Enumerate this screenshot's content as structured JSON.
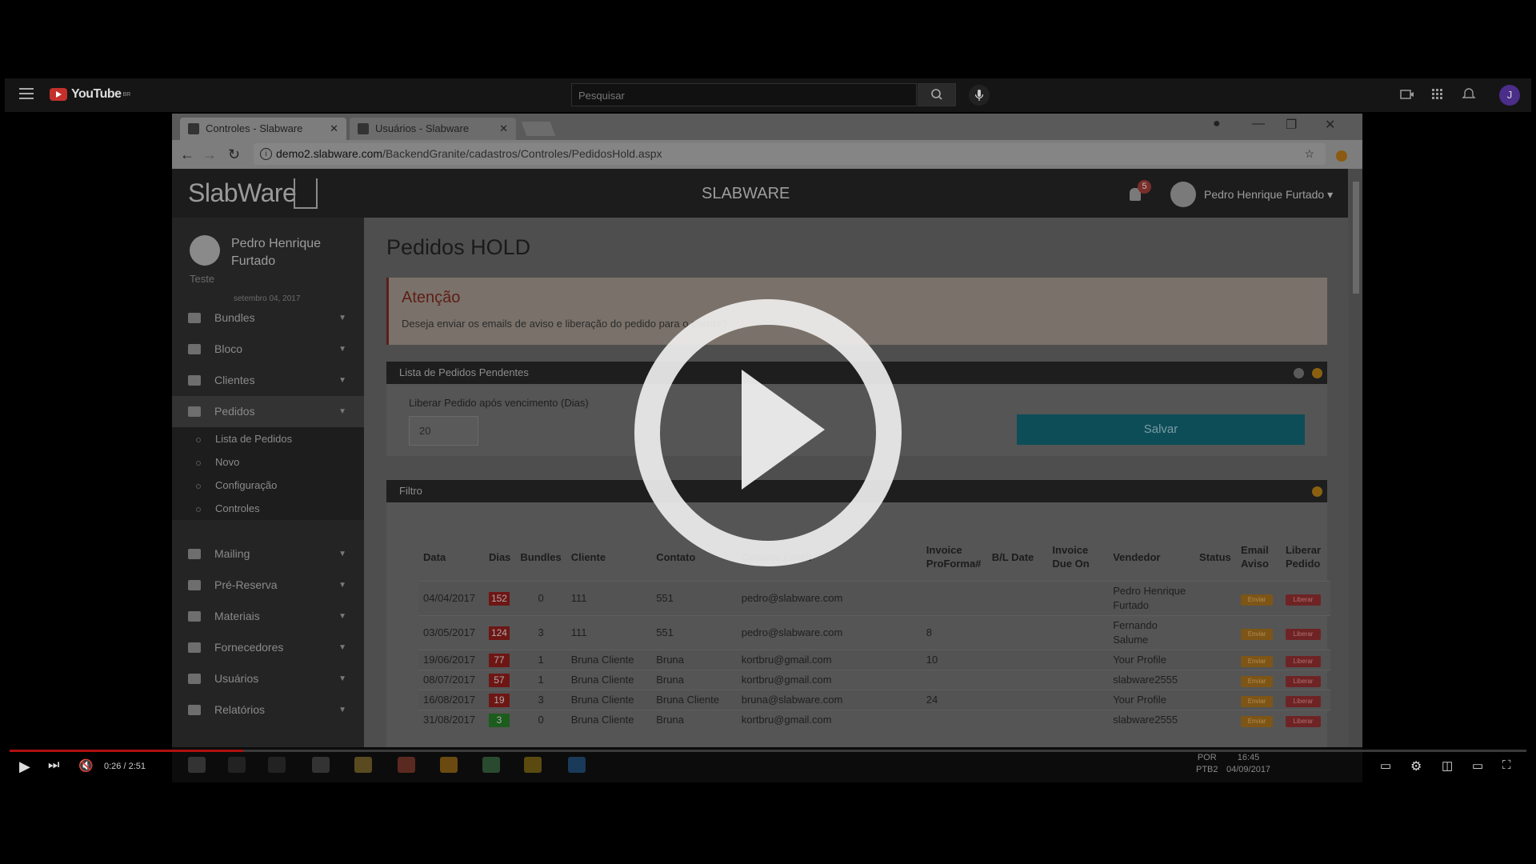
{
  "youtube": {
    "logo": "YouTube",
    "region": "BR",
    "search_placeholder": "Pesquisar",
    "avatar_letter": "J",
    "time": "0:26 / 2:51",
    "progress_fraction": 0.154
  },
  "browser": {
    "tabs": [
      {
        "label": "Controles - Slabware",
        "active": true
      },
      {
        "label": "Usuários - Slabware",
        "active": false
      }
    ],
    "url_host": "demo2.slabware.com",
    "url_path": "/BackendGranite/cadastros/Controles/PedidosHold.aspx"
  },
  "app": {
    "brand": "SlabWare",
    "title": "SLABWARE",
    "notifications": "5",
    "user_name": "Pedro Henrique Furtado"
  },
  "sidebar": {
    "profile_name": "Pedro Henrique Furtado",
    "profile_role": "Teste",
    "profile_date": "setembro 04, 2017",
    "items": [
      {
        "label": "Bundles"
      },
      {
        "label": "Bloco"
      },
      {
        "label": "Clientes"
      },
      {
        "label": "Pedidos"
      },
      {
        "label": "Mailing"
      },
      {
        "label": "Pré-Reserva"
      },
      {
        "label": "Materiais"
      },
      {
        "label": "Fornecedores"
      },
      {
        "label": "Usuários"
      },
      {
        "label": "Relatórios"
      }
    ],
    "pedidos_sub": [
      "Lista de Pedidos",
      "Novo",
      "Configuração",
      "Controles"
    ]
  },
  "page": {
    "title": "Pedidos HOLD",
    "alert_title": "Atenção",
    "alert_text": "Deseja enviar os emails de aviso e liberação do pedido para o cliente?",
    "panel1_title": "Lista de Pedidos Pendentes",
    "field_label": "Liberar Pedido após vencimento (Dias)",
    "field_value": "20",
    "save_label": "Salvar",
    "panel2_title": "Filtro"
  },
  "table": {
    "headers": [
      "Data",
      "Dias",
      "Bundles",
      "Cliente",
      "Contato",
      "Contato Email",
      "Invoice ProForma#",
      "B/L Date",
      "Invoice Due On",
      "Vendedor",
      "Status",
      "Email Aviso",
      "Liberar Pedido"
    ],
    "rows": [
      {
        "data": "04/04/2017",
        "dias": "152",
        "dias_color": "red",
        "bundles": "0",
        "cliente": "111",
        "contato": "551",
        "email": "pedro@slabware.com",
        "invoice": "",
        "bl": "",
        "due": "",
        "vendedor": "Pedro Henrique Furtado",
        "status": "",
        "enviar": "Enviar",
        "liberar": "Liberar"
      },
      {
        "data": "03/05/2017",
        "dias": "124",
        "dias_color": "red",
        "bundles": "3",
        "cliente": "111",
        "contato": "551",
        "email": "pedro@slabware.com",
        "invoice": "8",
        "bl": "",
        "due": "",
        "vendedor": "Fernando Salume",
        "status": "",
        "enviar": "Enviar",
        "liberar": "Liberar"
      },
      {
        "data": "19/06/2017",
        "dias": "77",
        "dias_color": "red",
        "bundles": "1",
        "cliente": "Bruna Cliente",
        "contato": "Bruna",
        "email": "kortbru@gmail.com",
        "invoice": "10",
        "bl": "",
        "due": "",
        "vendedor": "Your Profile",
        "status": "",
        "enviar": "Enviar",
        "liberar": "Liberar"
      },
      {
        "data": "08/07/2017",
        "dias": "57",
        "dias_color": "red",
        "bundles": "1",
        "cliente": "Bruna Cliente",
        "contato": "Bruna",
        "email": "kortbru@gmail.com",
        "invoice": "",
        "bl": "",
        "due": "",
        "vendedor": "slabware2555",
        "status": "",
        "enviar": "Enviar",
        "liberar": "Liberar"
      },
      {
        "data": "16/08/2017",
        "dias": "19",
        "dias_color": "red",
        "bundles": "3",
        "cliente": "Bruna Cliente",
        "contato": "Bruna Cliente",
        "email": "bruna@slabware.com",
        "invoice": "24",
        "bl": "",
        "due": "",
        "vendedor": "Your Profile",
        "status": "",
        "enviar": "Enviar",
        "liberar": "Liberar"
      },
      {
        "data": "31/08/2017",
        "dias": "3",
        "dias_color": "green",
        "bundles": "0",
        "cliente": "Bruna Cliente",
        "contato": "Bruna",
        "email": "kortbru@gmail.com",
        "invoice": "",
        "bl": "",
        "due": "",
        "vendedor": "slabware2555",
        "status": "",
        "enviar": "Enviar",
        "liberar": "Liberar"
      }
    ]
  },
  "taskbar": {
    "lang": "POR",
    "layout": "PTB2",
    "clock_time": "16:45",
    "clock_date": "04/09/2017"
  }
}
